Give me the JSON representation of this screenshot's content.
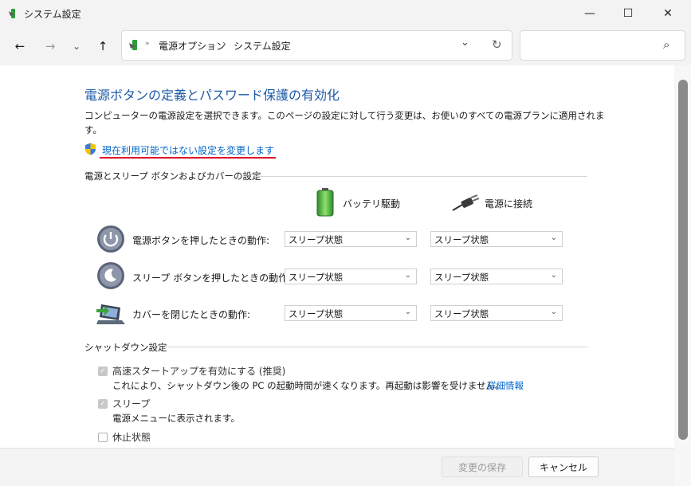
{
  "window": {
    "title": "システム設定",
    "minimize_glyph": "—",
    "maximize_glyph": "☐",
    "close_glyph": "✕"
  },
  "nav": {
    "back_glyph": "←",
    "forward_glyph": "→",
    "recent_glyph": "⌄",
    "up_glyph": "↑",
    "breadcrumb": [
      "電源オプション",
      "システム設定"
    ],
    "breadcrumb_sep": "›",
    "dropdown_glyph": "⌄",
    "refresh_glyph": "↻",
    "search_placeholder": "",
    "search_glyph": "⌕"
  },
  "page": {
    "title": "電源ボタンの定義とパスワード保護の有効化",
    "description_line1": "コンピューターの電源設定を選択できます。このページの設定に対して行う変更は、お使いのすべての電源プランに適用されま",
    "description_line2": "す。",
    "change_link": "現在利用可能ではない設定を変更します"
  },
  "power_section": {
    "header": "電源とスリープ ボタンおよびカバーの設定",
    "col_battery": "バッテリ駆動",
    "col_plugged": "電源に接続",
    "rows": [
      {
        "label": "電源ボタンを押したときの動作:",
        "battery": "スリープ状態",
        "plugged": "スリープ状態"
      },
      {
        "label": "スリープ ボタンを押したときの動作:",
        "battery": "スリープ状態",
        "plugged": "スリープ状態"
      },
      {
        "label": "カバーを閉じたときの動作:",
        "battery": "スリープ状態",
        "plugged": "スリープ状態"
      }
    ]
  },
  "shutdown_section": {
    "header": "シャットダウン設定",
    "fast_startup": {
      "label": "高速スタートアップを有効にする (推奨)",
      "checked": true,
      "desc": "これにより、シャットダウン後の PC の起動時間が速くなります。再起動は影響を受けません。",
      "link": "詳細情報"
    },
    "sleep": {
      "label": "スリープ",
      "checked": true,
      "desc": "電源メニューに表示されます。"
    },
    "hibernate": {
      "label": "休止状態",
      "checked": false
    }
  },
  "footer": {
    "save_label": "変更の保存",
    "cancel_label": "キャンセル"
  },
  "colors": {
    "title_blue": "#1c5aa6",
    "link_blue": "#0066cc",
    "underline_red": "#e0142a"
  }
}
